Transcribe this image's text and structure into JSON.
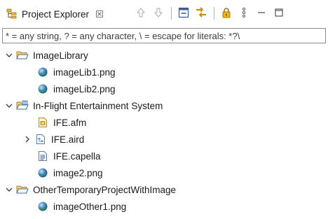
{
  "view": {
    "title": "Project Explorer",
    "toolbar": {
      "buttons": [
        {
          "name": "back-button",
          "icon": "arrow-up-icon"
        },
        {
          "name": "forward-button",
          "icon": "arrow-down-icon"
        },
        {
          "name": "collapse-all-button",
          "icon": "collapse-all-icon"
        },
        {
          "name": "link-with-editor-button",
          "icon": "link-with-editor-icon"
        },
        {
          "name": "lock-button",
          "icon": "lock-icon"
        },
        {
          "name": "view-menu-button",
          "icon": "vertical-dots-icon"
        },
        {
          "name": "minimize-button",
          "icon": "minimize-icon"
        },
        {
          "name": "maximize-button",
          "icon": "maximize-icon"
        }
      ]
    }
  },
  "filter": {
    "placeholder": "* = any string, ? = any character, \\ = escape for literals: *?\\"
  },
  "tree": {
    "items": [
      {
        "label": "ImageLibrary",
        "icon": "open-folder-icon",
        "expanded": true
      },
      {
        "label": "imageLib1.png",
        "icon": "image-file-icon"
      },
      {
        "label": "imageLib2.png",
        "icon": "image-file-icon"
      },
      {
        "label": "In-Flight Entertainment System",
        "icon": "capella-project-icon",
        "expanded": true
      },
      {
        "label": "IFE.afm",
        "icon": "afm-file-icon"
      },
      {
        "label": "IFE.aird",
        "icon": "aird-file-icon",
        "expanded": false
      },
      {
        "label": "IFE.capella",
        "icon": "capella-file-icon"
      },
      {
        "label": "image2.png",
        "icon": "image-file-icon"
      },
      {
        "label": "OtherTemporaryProjectWithImage",
        "icon": "open-folder-icon",
        "expanded": true
      },
      {
        "label": "imageOther1.png",
        "icon": "image-file-icon"
      }
    ]
  },
  "colors": {
    "folder": "#e8b23c",
    "folder_dark": "#b88520",
    "sphere": "#3c8bc4",
    "arrow_disabled": "#b9b9b9",
    "lock": "#e4a512"
  }
}
